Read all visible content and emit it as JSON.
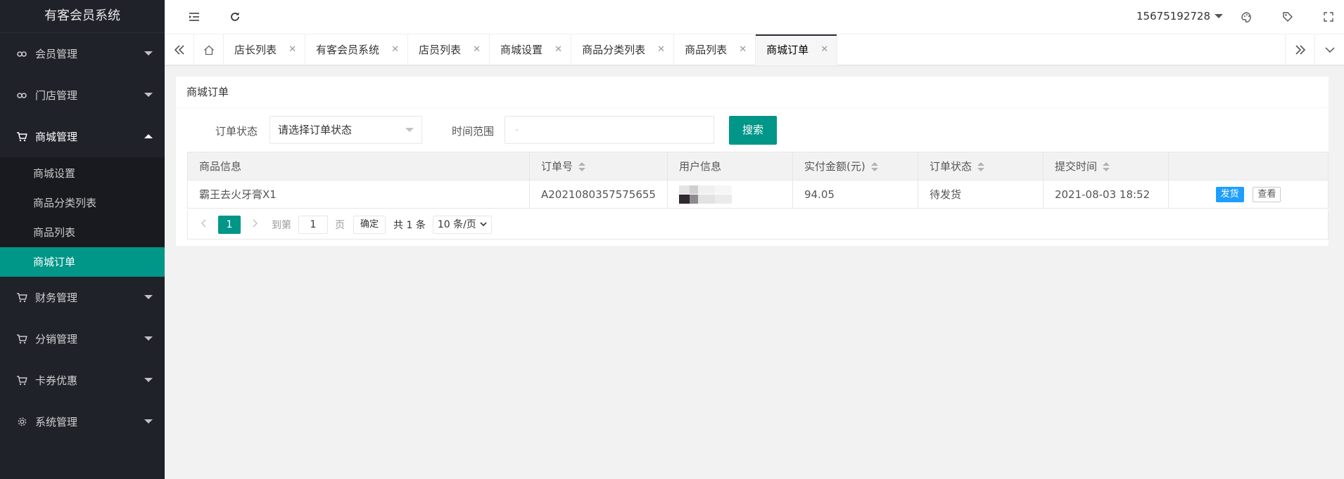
{
  "app": {
    "title": "有客会员系统"
  },
  "sidebar": {
    "items": [
      {
        "label": "会员管理",
        "icon": "link-icon"
      },
      {
        "label": "门店管理",
        "icon": "link-icon"
      },
      {
        "label": "商城管理",
        "icon": "cart-icon",
        "expanded": true,
        "children": [
          {
            "label": "商城设置"
          },
          {
            "label": "商品分类列表"
          },
          {
            "label": "商品列表"
          },
          {
            "label": "商城订单",
            "active": true
          }
        ]
      },
      {
        "label": "财务管理",
        "icon": "cart-icon"
      },
      {
        "label": "分销管理",
        "icon": "cart-icon"
      },
      {
        "label": "卡券优惠",
        "icon": "cart-icon"
      },
      {
        "label": "系统管理",
        "icon": "gear-icon"
      }
    ]
  },
  "header": {
    "user": "15675192728",
    "icons": [
      "menu-fold-icon",
      "refresh-icon",
      "theme-icon",
      "tag-icon",
      "fullscreen-icon"
    ]
  },
  "tabs": [
    {
      "label": "店长列表"
    },
    {
      "label": "有客会员系统"
    },
    {
      "label": "店员列表"
    },
    {
      "label": "商城设置"
    },
    {
      "label": "商品分类列表"
    },
    {
      "label": "商品列表"
    },
    {
      "label": "商城订单",
      "active": true
    }
  ],
  "card": {
    "title": "商城订单",
    "filter": {
      "status_label": "订单状态",
      "status_placeholder": "请选择订单状态",
      "time_label": "时间范围",
      "time_placeholder": "-",
      "search_label": "搜索"
    }
  },
  "table": {
    "headers": [
      "商品信息",
      "订单号",
      "用户信息",
      "实付金额(元)",
      "订单状态",
      "提交时间",
      ""
    ],
    "rows": [
      {
        "product": "霸王去火牙膏X1",
        "order_no": "A2021080357575655",
        "user": "",
        "amount": "94.05",
        "status": "待发货",
        "time": "2021-08-03 18:52",
        "actions": [
          "发货",
          "查看"
        ]
      }
    ]
  },
  "pager": {
    "current": "1",
    "goto_label": "到第",
    "goto_value": "1",
    "page_label": "页",
    "confirm": "确定",
    "total": "共 1 条",
    "page_size": "10 条/页"
  },
  "colors": {
    "accent": "#009688",
    "sidebar_bg": "#20222a",
    "primary_btn": "#1e9fff"
  }
}
